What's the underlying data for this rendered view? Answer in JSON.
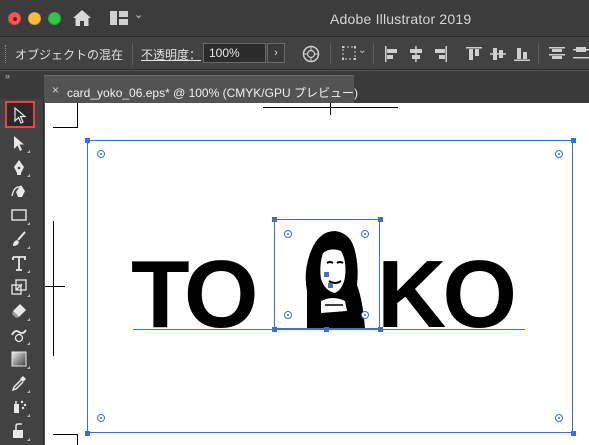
{
  "app": {
    "title": "Adobe Illustrator 2019"
  },
  "control_bar": {
    "selection_label": "オブジェクトの混在",
    "opacity_label": "不透明度：",
    "opacity_value": "100%",
    "opacity_button": "›"
  },
  "document_tab": {
    "close": "×",
    "title": "card_yoko_06.eps* @ 100% (CMYK/GPU プレビュー)"
  },
  "artwork": {
    "left_text": "TO",
    "right_text": "KO"
  },
  "tools": [
    {
      "name": "selection-tool",
      "icon": "selection-arrow-icon",
      "active": true
    },
    {
      "name": "direct-selection-tool",
      "icon": "direct-selection-icon"
    },
    {
      "name": "pen-tool",
      "icon": "pen-icon"
    },
    {
      "name": "curvature-tool",
      "icon": "curvature-icon"
    },
    {
      "name": "rectangle-tool",
      "icon": "rectangle-icon"
    },
    {
      "name": "paintbrush-tool",
      "icon": "paintbrush-icon"
    },
    {
      "name": "type-tool",
      "icon": "type-icon"
    },
    {
      "name": "scale-tool",
      "icon": "scale-icon"
    },
    {
      "name": "eraser-tool",
      "icon": "eraser-icon"
    },
    {
      "name": "warp-tool",
      "icon": "warp-icon"
    },
    {
      "name": "gradient-tool",
      "icon": "gradient-icon"
    },
    {
      "name": "eyedropper-tool",
      "icon": "eyedropper-icon"
    },
    {
      "name": "symbol-sprayer-tool",
      "icon": "symbol-sprayer-icon"
    },
    {
      "name": "rotate-view-tool",
      "icon": "rotate-view-icon"
    }
  ],
  "colors": {
    "selection": "#3d6ed6",
    "active_tool_outline": "#e4463d"
  }
}
